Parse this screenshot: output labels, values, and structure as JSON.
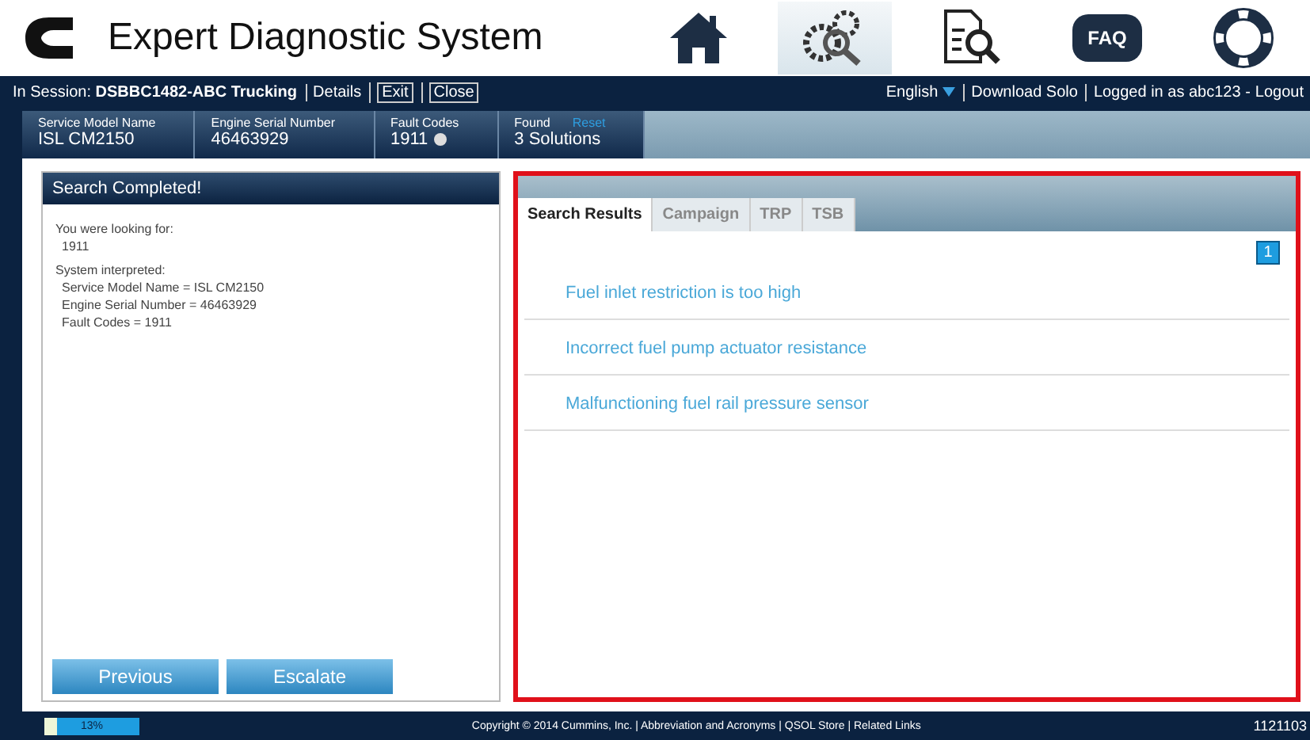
{
  "header": {
    "title": "Expert Diagnostic System",
    "nav_icons": [
      {
        "kind": "home",
        "selected": false
      },
      {
        "kind": "gears",
        "selected": true
      },
      {
        "kind": "document",
        "selected": false
      },
      {
        "kind": "faq",
        "label": "FAQ",
        "selected": false
      },
      {
        "kind": "lifebuoy",
        "selected": false
      }
    ]
  },
  "session_bar": {
    "label": "In Session:",
    "session": "DSBBC1482-ABC Trucking",
    "links": [
      "Details"
    ],
    "buttons": [
      "Exit",
      "Close"
    ],
    "language": "English",
    "right_links": [
      "Download Solo"
    ],
    "logged_in": "Logged in as  abc123 - ",
    "logout": "Logout"
  },
  "breadcrumb": [
    {
      "label": "Service Model Name",
      "value": "ISL CM2150"
    },
    {
      "label": "Engine Serial Number",
      "value": "46463929"
    },
    {
      "label": "Fault Codes",
      "value": "1911",
      "badge": true
    },
    {
      "label": "Found",
      "value": "3 Solutions",
      "reset": "Reset"
    }
  ],
  "search_panel": {
    "title": "Search Completed!",
    "lines": [
      {
        "text": "You were looking for:",
        "kind": "heading"
      },
      {
        "text": "1911",
        "kind": "value"
      },
      {
        "text": "System interpreted:",
        "kind": "heading"
      },
      {
        "text": "Service Model Name = ISL CM2150",
        "kind": "value"
      },
      {
        "text": "Engine Serial Number = 46463929",
        "kind": "value"
      },
      {
        "text": "Fault Codes = 1911",
        "kind": "value"
      }
    ],
    "buttons": [
      "Previous",
      "Escalate"
    ]
  },
  "results": {
    "tabs": [
      {
        "label": "Search Results",
        "selected": true
      },
      {
        "label": "Campaign",
        "selected": false
      },
      {
        "label": "TRP",
        "selected": false
      },
      {
        "label": "TSB",
        "selected": false
      }
    ],
    "page": "1",
    "items": [
      "Fuel inlet restriction is too high",
      "Incorrect fuel pump actuator resistance",
      "Malfunctioning fuel rail pressure sensor"
    ]
  },
  "footer": {
    "progress": {
      "level": 0.13,
      "reading": "13%"
    },
    "copyright": "Copyright © 2014 Cummins, Inc. | Abbreviation and Acronyms | QSOL Store | Related Links",
    "code": "1121103"
  }
}
